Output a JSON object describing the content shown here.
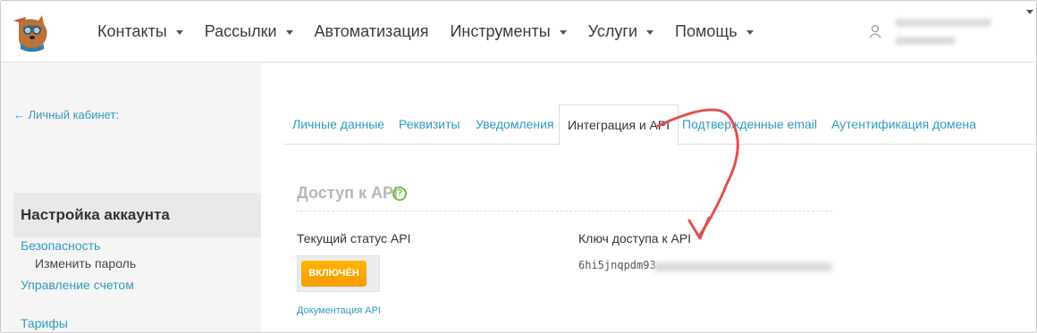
{
  "header": {
    "nav": [
      {
        "label": "Контакты",
        "has_caret": true
      },
      {
        "label": "Рассылки",
        "has_caret": true
      },
      {
        "label": "Автоматизация",
        "has_caret": false
      },
      {
        "label": "Инструменты",
        "has_caret": true
      },
      {
        "label": "Услуги",
        "has_caret": true
      },
      {
        "label": "Помощь",
        "has_caret": true
      }
    ],
    "user_icon": "user-outline-icon"
  },
  "sidebar": {
    "back_link": "← Личный кабинет:",
    "section_title": "Настройка аккаунта",
    "sub_item": "Изменить пароль",
    "links": [
      "Безопасность",
      "Управление счетом",
      "Тарифы"
    ]
  },
  "tabs": [
    {
      "label": "Личные данные",
      "active": false
    },
    {
      "label": "Реквизиты",
      "active": false
    },
    {
      "label": "Уведомления",
      "active": false
    },
    {
      "label": "Интеграция и API",
      "active": true
    },
    {
      "label": "Подтвержденные email",
      "active": false
    },
    {
      "label": "Аутентификация домена",
      "active": false
    }
  ],
  "api": {
    "title": "Доступ к API",
    "help_icon": "question-circle-icon",
    "status_label": "Текущий статус API",
    "status_button": "ВКЛЮЧЁН",
    "doc_link": "Документация API",
    "key_label": "Ключ доступа к API",
    "key_visible": "6hi5jnqpdm93"
  },
  "colors": {
    "link": "#2f9ac2",
    "status_button": "#f5a300",
    "annotation_arrow": "#e0504f",
    "help_icon": "#6cbf3e"
  }
}
